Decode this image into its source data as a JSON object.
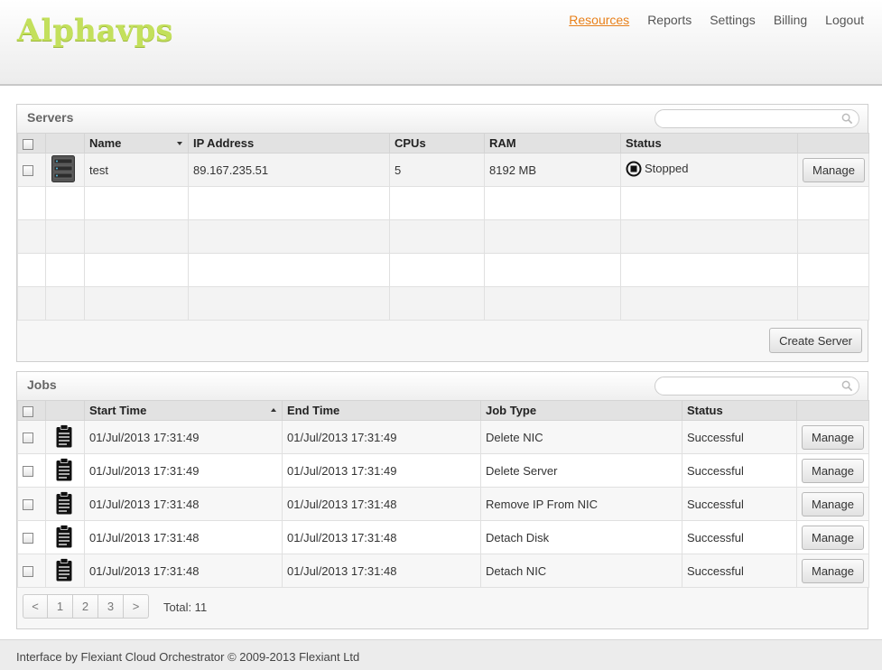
{
  "app": {
    "logo": "Alphavps"
  },
  "nav": {
    "items": [
      "Resources",
      "Reports",
      "Settings",
      "Billing",
      "Logout"
    ]
  },
  "servers": {
    "title": "Servers",
    "search_placeholder": "",
    "columns": [
      "Name",
      "IP Address",
      "CPUs",
      "RAM",
      "Status"
    ],
    "rows": [
      {
        "name": "test",
        "ip": "89.167.235.51",
        "cpus": "5",
        "ram": "8192 MB",
        "status": "Stopped",
        "action": "Manage"
      }
    ],
    "create_label": "Create Server"
  },
  "jobs": {
    "title": "Jobs",
    "search_placeholder": "",
    "columns": [
      "Start Time",
      "End Time",
      "Job Type",
      "Status"
    ],
    "rows": [
      {
        "start": "01/Jul/2013 17:31:49",
        "end": "01/Jul/2013 17:31:49",
        "type": "Delete NIC",
        "status": "Successful",
        "action": "Manage"
      },
      {
        "start": "01/Jul/2013 17:31:49",
        "end": "01/Jul/2013 17:31:49",
        "type": "Delete Server",
        "status": "Successful",
        "action": "Manage"
      },
      {
        "start": "01/Jul/2013 17:31:48",
        "end": "01/Jul/2013 17:31:48",
        "type": "Remove IP From NIC",
        "status": "Successful",
        "action": "Manage"
      },
      {
        "start": "01/Jul/2013 17:31:48",
        "end": "01/Jul/2013 17:31:48",
        "type": "Detach Disk",
        "status": "Successful",
        "action": "Manage"
      },
      {
        "start": "01/Jul/2013 17:31:48",
        "end": "01/Jul/2013 17:31:48",
        "type": "Detach NIC",
        "status": "Successful",
        "action": "Manage"
      }
    ],
    "pager": {
      "prev": "<",
      "pages": [
        "1",
        "2",
        "3"
      ],
      "next": ">"
    },
    "total": "Total: 11"
  },
  "footer": {
    "text": "Interface by Flexiant Cloud Orchestrator © 2009-2013 Flexiant Ltd"
  },
  "colors": {
    "logo": "#c3e05c",
    "active_nav": "#e8801a"
  },
  "icons": {
    "server": "server-icon",
    "job": "clipboard-icon",
    "stopped": "stop-circle-icon",
    "search": "search-icon"
  }
}
